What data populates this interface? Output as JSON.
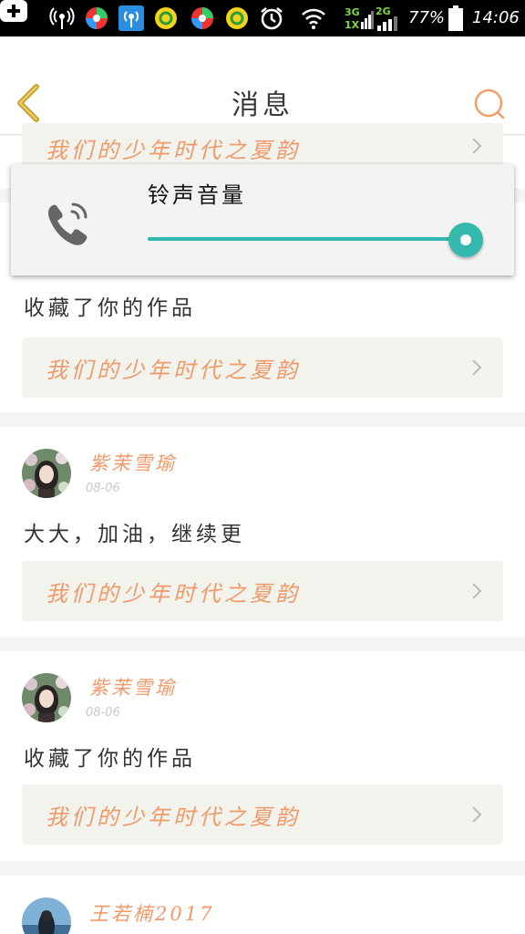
{
  "status_bar": {
    "battery_percent": "77%",
    "time": "14:06",
    "network_top": "3G",
    "network_bottom": "1X",
    "network_2g": "2G",
    "icons": [
      "plus-icon",
      "wifi-hotspot-icon",
      "app-icon",
      "wifi-hotspot-icon",
      "music-icon",
      "app-icon",
      "music-icon",
      "alarm-icon",
      "wifi-icon",
      "signal-icon",
      "battery-icon"
    ]
  },
  "header": {
    "title": "消息"
  },
  "volume_dialog": {
    "label": "铃声音量",
    "level": 1.0,
    "accent_color": "#2fb8ab"
  },
  "messages": [
    {
      "content": "",
      "work_title": "我们的少年时代之夏韵"
    },
    {
      "content": "收藏了你的作品",
      "work_title": "我们的少年时代之夏韵"
    },
    {
      "user": "紫茉雪瑜",
      "date": "08-06",
      "content": "大大，加油，继续更",
      "work_title": "我们的少年时代之夏韵"
    },
    {
      "user": "紫茉雪瑜",
      "date": "08-06",
      "content": "收藏了你的作品",
      "work_title": "我们的少年时代之夏韵"
    },
    {
      "user": "王若楠2017",
      "date": ""
    }
  ],
  "colors": {
    "accent_orange": "#f09a6a",
    "back_icon": "#c6a23a",
    "teal": "#2fb8ab"
  }
}
